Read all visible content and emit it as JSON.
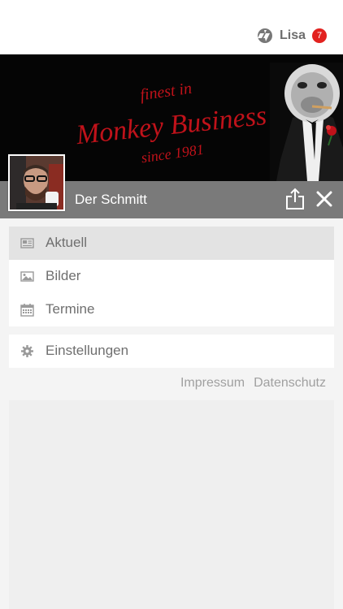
{
  "header": {
    "user_name": "Lisa",
    "notification_count": "7",
    "logo_icon": "app-logo-icon"
  },
  "cover": {
    "line1": "finest in",
    "brand": "Monkey Business",
    "line3": "since 1981",
    "text_color": "#c0121a",
    "background": "#050505"
  },
  "profile": {
    "name": "Der Schmitt",
    "share_icon": "share-icon",
    "close_icon": "close-icon"
  },
  "menu": {
    "items": [
      {
        "label": "Aktuell",
        "icon": "newspaper-icon",
        "active": true
      },
      {
        "label": "Bilder",
        "icon": "image-icon",
        "active": false
      },
      {
        "label": "Termine",
        "icon": "calendar-icon",
        "active": false
      }
    ],
    "settings": {
      "label": "Einstellungen",
      "icon": "gear-icon"
    }
  },
  "footer": {
    "impressum": "Impressum",
    "datenschutz": "Datenschutz"
  },
  "colors": {
    "accent": "#e2221f",
    "bar_gray": "#7a7a7a",
    "text_gray": "#6f6f6f"
  }
}
